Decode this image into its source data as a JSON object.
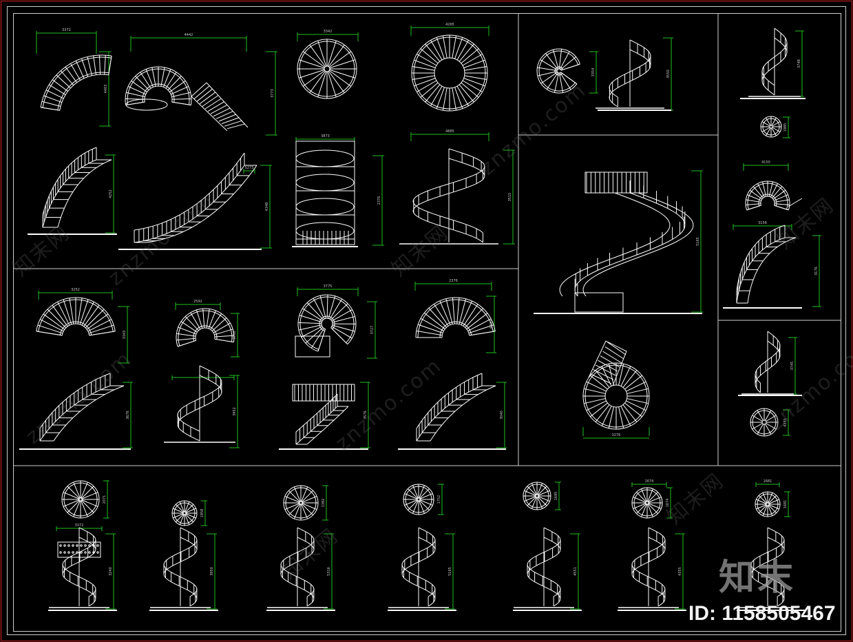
{
  "colors": {
    "background": "#000000",
    "frame_outer": "#7a1414",
    "frame_inner": "#cfcfcf",
    "geometry": "#ffffff",
    "dimension": "#1fbf1f"
  },
  "watermark": {
    "site": "znzmo.com",
    "brand": "知末网",
    "logo": "知末"
  },
  "id_label": "ID: 1158505467",
  "dims": {
    "d1": "3372",
    "d2": "4442",
    "d3": "3342",
    "d4": "4265",
    "d5": "4885",
    "d6": "3252",
    "d7": "2592",
    "d8": "4403",
    "d9": "3773",
    "d10": "4252",
    "d11": "4348",
    "d12": "3873",
    "d13": "3775",
    "d14": "2376",
    "d15": "5273",
    "d16": "2376",
    "d17": "3515",
    "d18": "3343",
    "d19": "3750",
    "d20": "3727",
    "d21": "4030",
    "d22": "3676",
    "d23": "3952",
    "d24": "3576",
    "d25": "3040",
    "d26": "3354",
    "d27": "3550",
    "d28": "5165",
    "d29": "3276",
    "d30": "3748",
    "d31": "4150",
    "d32": "3176",
    "d33": "1985",
    "d34": "3156",
    "d35": "3372",
    "d36": "2071",
    "d37": "1958",
    "d38": "1752",
    "d39": "1382",
    "d40": "1695",
    "d41": "1674",
    "d42": "1681",
    "d43": "3240",
    "d44": "3745",
    "d45": "3950",
    "d46": "5316",
    "d47": "4551",
    "d48": "4355"
  }
}
